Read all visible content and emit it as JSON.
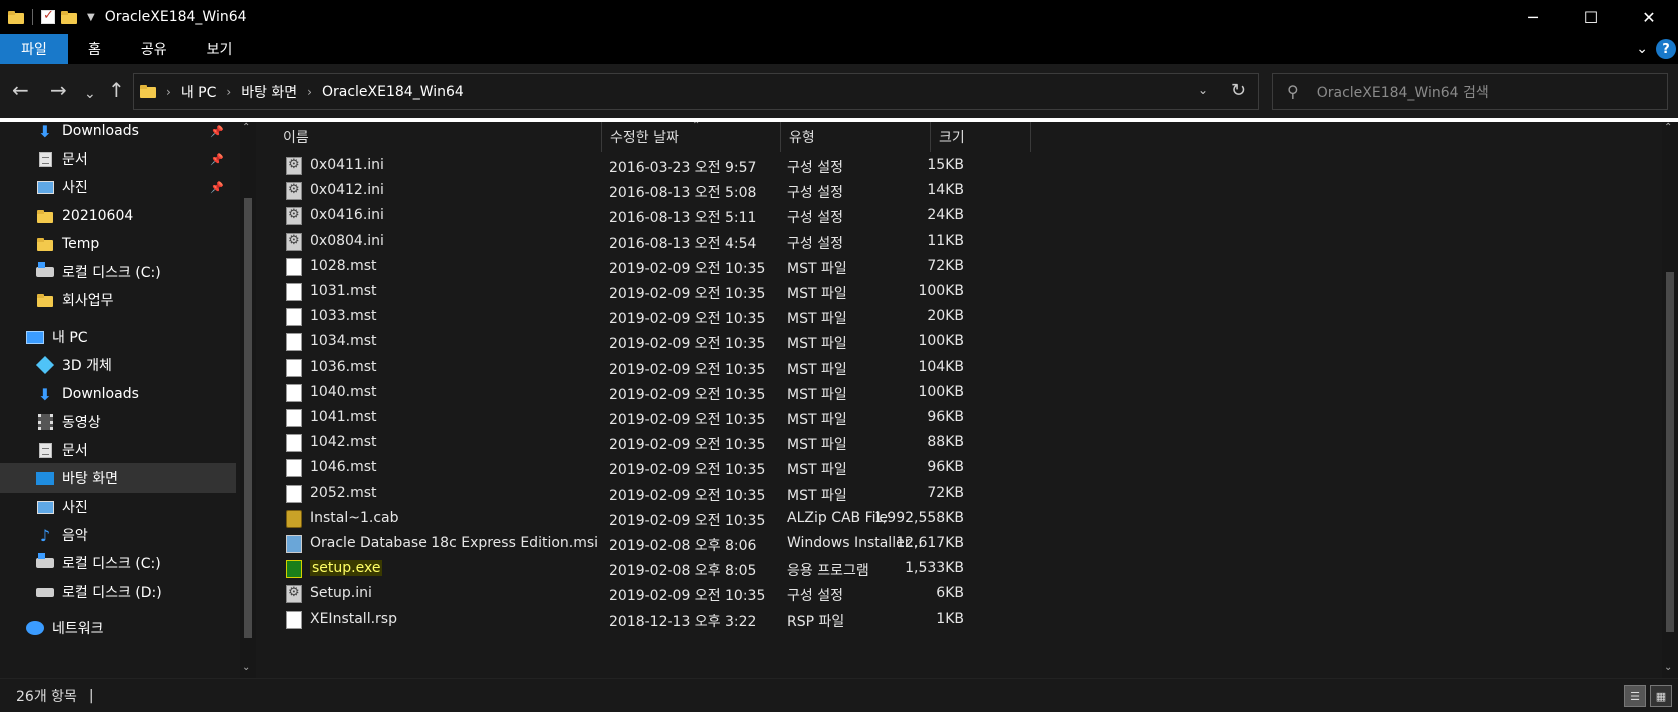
{
  "window": {
    "title": "OracleXE184_Win64",
    "minimize": "─",
    "maximize": "☐",
    "close": "✕"
  },
  "ribbon": {
    "tabs": [
      "파일",
      "홈",
      "공유",
      "보기"
    ],
    "collapse": "⌄",
    "help": "?"
  },
  "nav_buttons": {
    "back": "←",
    "forward": "→",
    "recent": "⌄",
    "up": "↑"
  },
  "address": {
    "crumbs": [
      "내 PC",
      "바탕 화면",
      "OracleXE184_Win64"
    ],
    "sep": "›",
    "dropdown": "⌄",
    "refresh": "↻"
  },
  "search": {
    "placeholder": "OracleXE184_Win64 검색",
    "icon": "⚲"
  },
  "navpane": {
    "items": [
      {
        "label": "Downloads",
        "icon": "download-icon",
        "pinned": true
      },
      {
        "label": "문서",
        "icon": "document-icon",
        "pinned": true
      },
      {
        "label": "사진",
        "icon": "pictures-icon",
        "pinned": true
      },
      {
        "label": "20210604",
        "icon": "folder-icon",
        "pinned": false
      },
      {
        "label": "Temp",
        "icon": "folder-icon",
        "pinned": false
      },
      {
        "label": "로컬 디스크 (C:)",
        "icon": "drive-icon",
        "pinned": false
      },
      {
        "label": "회사업무",
        "icon": "folder-icon",
        "pinned": false
      },
      {
        "label": "내 PC",
        "icon": "pc-icon",
        "pinned": false
      },
      {
        "label": "3D 개체",
        "icon": "3d-objects-icon",
        "pinned": false
      },
      {
        "label": "Downloads",
        "icon": "download-icon",
        "pinned": false
      },
      {
        "label": "동영상",
        "icon": "video-icon",
        "pinned": false
      },
      {
        "label": "문서",
        "icon": "document-icon",
        "pinned": false
      },
      {
        "label": "바탕 화면",
        "icon": "desktop-icon",
        "pinned": false
      },
      {
        "label": "사진",
        "icon": "pictures-icon",
        "pinned": false
      },
      {
        "label": "음악",
        "icon": "music-icon",
        "pinned": false
      },
      {
        "label": "로컬 디스크 (C:)",
        "icon": "drive-icon",
        "pinned": false
      },
      {
        "label": "로컬 디스크 (D:)",
        "icon": "drive-icon",
        "pinned": false
      },
      {
        "label": "네트워크",
        "icon": "network-icon",
        "pinned": false
      }
    ],
    "selected": "바탕 화면"
  },
  "columns": {
    "name": "이름",
    "date": "수정한 날짜",
    "type": "유형",
    "size": "크기"
  },
  "files": [
    {
      "name": "0x0411.ini",
      "date": "2016-03-23 오전 9:57",
      "type": "구성 설정",
      "size": "15KB",
      "icon": "ini"
    },
    {
      "name": "0x0412.ini",
      "date": "2016-08-13 오전 5:08",
      "type": "구성 설정",
      "size": "14KB",
      "icon": "ini"
    },
    {
      "name": "0x0416.ini",
      "date": "2016-08-13 오전 5:11",
      "type": "구성 설정",
      "size": "24KB",
      "icon": "ini"
    },
    {
      "name": "0x0804.ini",
      "date": "2016-08-13 오전 4:54",
      "type": "구성 설정",
      "size": "11KB",
      "icon": "ini"
    },
    {
      "name": "1028.mst",
      "date": "2019-02-09 오전 10:35",
      "type": "MST 파일",
      "size": "72KB",
      "icon": "doc"
    },
    {
      "name": "1031.mst",
      "date": "2019-02-09 오전 10:35",
      "type": "MST 파일",
      "size": "100KB",
      "icon": "doc"
    },
    {
      "name": "1033.mst",
      "date": "2019-02-09 오전 10:35",
      "type": "MST 파일",
      "size": "20KB",
      "icon": "doc"
    },
    {
      "name": "1034.mst",
      "date": "2019-02-09 오전 10:35",
      "type": "MST 파일",
      "size": "100KB",
      "icon": "doc"
    },
    {
      "name": "1036.mst",
      "date": "2019-02-09 오전 10:35",
      "type": "MST 파일",
      "size": "104KB",
      "icon": "doc"
    },
    {
      "name": "1040.mst",
      "date": "2019-02-09 오전 10:35",
      "type": "MST 파일",
      "size": "100KB",
      "icon": "doc"
    },
    {
      "name": "1041.mst",
      "date": "2019-02-09 오전 10:35",
      "type": "MST 파일",
      "size": "96KB",
      "icon": "doc"
    },
    {
      "name": "1042.mst",
      "date": "2019-02-09 오전 10:35",
      "type": "MST 파일",
      "size": "88KB",
      "icon": "doc"
    },
    {
      "name": "1046.mst",
      "date": "2019-02-09 오전 10:35",
      "type": "MST 파일",
      "size": "96KB",
      "icon": "doc"
    },
    {
      "name": "2052.mst",
      "date": "2019-02-09 오전 10:35",
      "type": "MST 파일",
      "size": "72KB",
      "icon": "doc"
    },
    {
      "name": "Instal~1.cab",
      "date": "2019-02-09 오전 10:35",
      "type": "ALZip CAB File",
      "size": "1,992,558KB",
      "icon": "cab"
    },
    {
      "name": "Oracle Database 18c Express Edition.msi",
      "date": "2019-02-08 오후 8:06",
      "type": "Windows Installer...",
      "size": "12,617KB",
      "icon": "msi"
    },
    {
      "name": "setup.exe",
      "date": "2019-02-08 오후 8:05",
      "type": "응용 프로그램",
      "size": "1,533KB",
      "icon": "exe",
      "highlighted": true
    },
    {
      "name": "Setup.ini",
      "date": "2019-02-09 오전 10:35",
      "type": "구성 설정",
      "size": "6KB",
      "icon": "ini"
    },
    {
      "name": "XEInstall.rsp",
      "date": "2018-12-13 오후 3:22",
      "type": "RSP 파일",
      "size": "1KB",
      "icon": "doc"
    }
  ],
  "status": {
    "count": "26개 항목",
    "cursor": "|"
  },
  "view_buttons": {
    "details": "☰",
    "large_icons": "▦"
  }
}
